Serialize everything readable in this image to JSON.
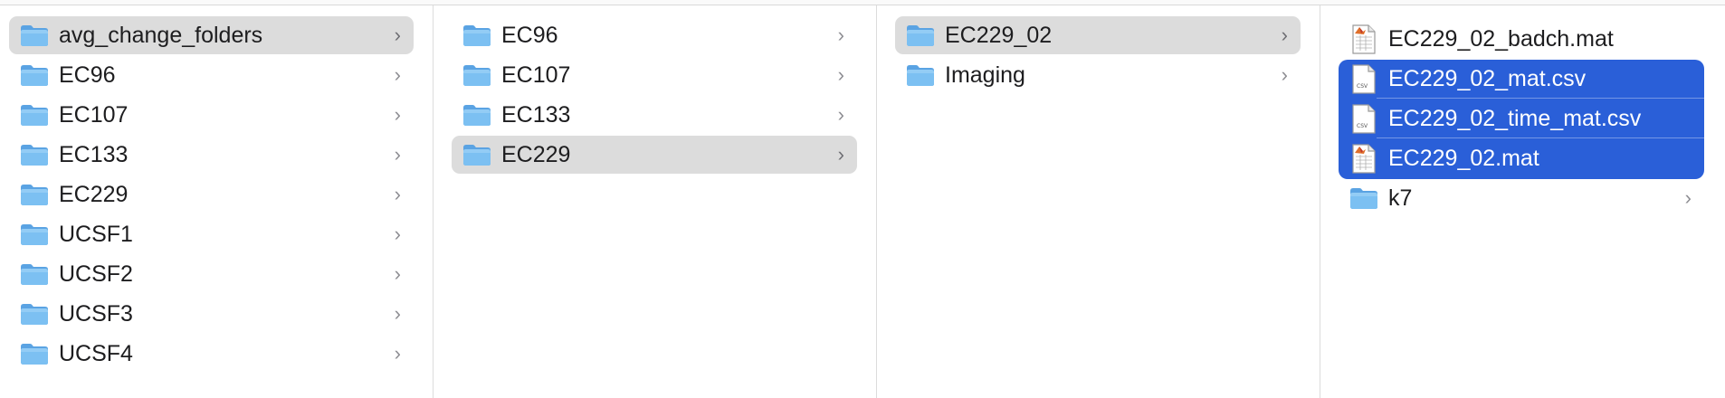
{
  "columns": [
    {
      "items": [
        {
          "label": "avg_change_folders",
          "type": "folder",
          "state": "selected",
          "chevron": true
        },
        {
          "label": "EC96",
          "type": "folder",
          "chevron": true
        },
        {
          "label": "EC107",
          "type": "folder",
          "chevron": true
        },
        {
          "label": "EC133",
          "type": "folder",
          "chevron": true
        },
        {
          "label": "EC229",
          "type": "folder",
          "chevron": true
        },
        {
          "label": "UCSF1",
          "type": "folder",
          "chevron": true
        },
        {
          "label": "UCSF2",
          "type": "folder",
          "chevron": true
        },
        {
          "label": "UCSF3",
          "type": "folder",
          "chevron": true
        },
        {
          "label": "UCSF4",
          "type": "folder",
          "chevron": true
        }
      ]
    },
    {
      "items": [
        {
          "label": "EC96",
          "type": "folder",
          "chevron": true
        },
        {
          "label": "EC107",
          "type": "folder",
          "chevron": true
        },
        {
          "label": "EC133",
          "type": "folder",
          "chevron": true
        },
        {
          "label": "EC229",
          "type": "folder",
          "state": "selected",
          "chevron": true
        }
      ]
    },
    {
      "items": [
        {
          "label": "EC229_02",
          "type": "folder",
          "state": "selected",
          "chevron": true
        },
        {
          "label": "Imaging",
          "type": "folder",
          "chevron": true
        }
      ]
    },
    {
      "items": [
        {
          "label": "EC229_02_badch.mat",
          "type": "mat-file"
        },
        {
          "label": "EC229_02_mat.csv",
          "type": "csv-file",
          "state": "highlighted"
        },
        {
          "label": "EC229_02_time_mat.csv",
          "type": "csv-file",
          "state": "highlighted"
        },
        {
          "label": "EC229_02.mat",
          "type": "mat-file",
          "state": "highlighted"
        },
        {
          "label": "k7",
          "type": "folder",
          "chevron": true
        }
      ]
    }
  ],
  "chevron_glyph": "›",
  "csv_icon_text": "CSV",
  "colors": {
    "selection_gray": "#dcdcdc",
    "selection_blue": "#2a5fd8",
    "folder_blue": "#6fb3ec"
  }
}
